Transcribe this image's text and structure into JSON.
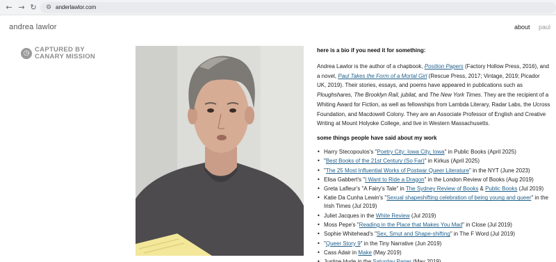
{
  "browser": {
    "back_icon": "←",
    "forward_icon": "→",
    "reload_icon": "↻",
    "site_info_icon": "⚙",
    "url": "anderlawlor.com"
  },
  "header": {
    "site_title": "andrea lawlor",
    "nav": {
      "about": "about",
      "paul": "paul"
    }
  },
  "watermark": {
    "icon": "◷",
    "line1": "CAPTURED BY",
    "line2": "CANARY MISSION"
  },
  "bio": {
    "heading": "here is a bio if you need it for something:",
    "p1_a": "Andrea Lawlor is the author of a chapbook, ",
    "link_position_papers": "Position Papers",
    "p1_b": " (Factory Hollow Press, 2016), and a novel, ",
    "link_paul": "Paul Takes the Form of a Mortal Girl",
    "p1_c": " (Rescue Press, 2017; Vintage, 2019; Picador UK, 2019). Their stories, essays, and poems have appeared in publications such as ",
    "pub_ploughshares": "Ploughshares, The Brooklyn Rail, jubilat,",
    "p1_d": " and ",
    "pub_nyt": "The New York Times",
    "p1_e": ". They are the recipient of a Whiting Award for Fiction, as well as fellowships from Lambda Literary, Radar Labs, the Ucross Foundation, and Macdowell Colony. They are an Associate Professor of English and Creative Writing at Mount Holyoke College, and live in Western Massachusetts."
  },
  "praise": {
    "heading": "some things people have said about my work",
    "items": [
      {
        "pre": "Harry Stecopoulos's \"",
        "link": "Poetry City: Iowa City, Iowa",
        "post": "\" in Public Books (April 2025)"
      },
      {
        "pre": "\"",
        "link": "Best Books of the 21st Century (So Far)",
        "post": "\" in Kirkus (April 2025)"
      },
      {
        "pre": "\"",
        "link": "The 25 Most Influential Works of Postwar Queer Literature",
        "post": "\" in the NYT (June 2023)"
      },
      {
        "pre": "Elisa Gabbert's \"",
        "link": "I Want to Ride a Dragon",
        "post": "\" in the London Review of Books (Aug 2019)"
      },
      {
        "pre": "Greta Lafleur's \"A Fairy's Tale\" in ",
        "link": "The Sydney Review of Books",
        "mid": " & ",
        "link2": "Public Books",
        "post": " (Jul 2019)"
      },
      {
        "pre": "Katie Da Cunha Lewin's \"",
        "link": "Sexual shapeshifting celebration of being young and queer",
        "post": "\" in the Irish Times (Jul 2019)"
      },
      {
        "pre": "Juliet Jacques in the ",
        "link": "White Review",
        "post": " (Jul 2019)"
      },
      {
        "pre": "Moss Pepe's \"",
        "link": "Reading in the Place that Makes You Mad",
        "post": "\" in Close (Jul 2019)"
      },
      {
        "pre": "Sophie Whitehead's \"",
        "link": "Sex, Smut and Shape-shifting",
        "post": "\" in The F Word (Jul 2019)"
      },
      {
        "pre": "\"",
        "link": "Queer Story 9",
        "post": "\" in the Tiny Narrative (Jun 2019)"
      },
      {
        "pre": "Cass Adair in ",
        "link": "Make",
        "post": " (May 2019)"
      },
      {
        "pre": "Justine Hyde in the ",
        "link": "Saturday Paper",
        "post": " (May 2019)"
      }
    ]
  }
}
